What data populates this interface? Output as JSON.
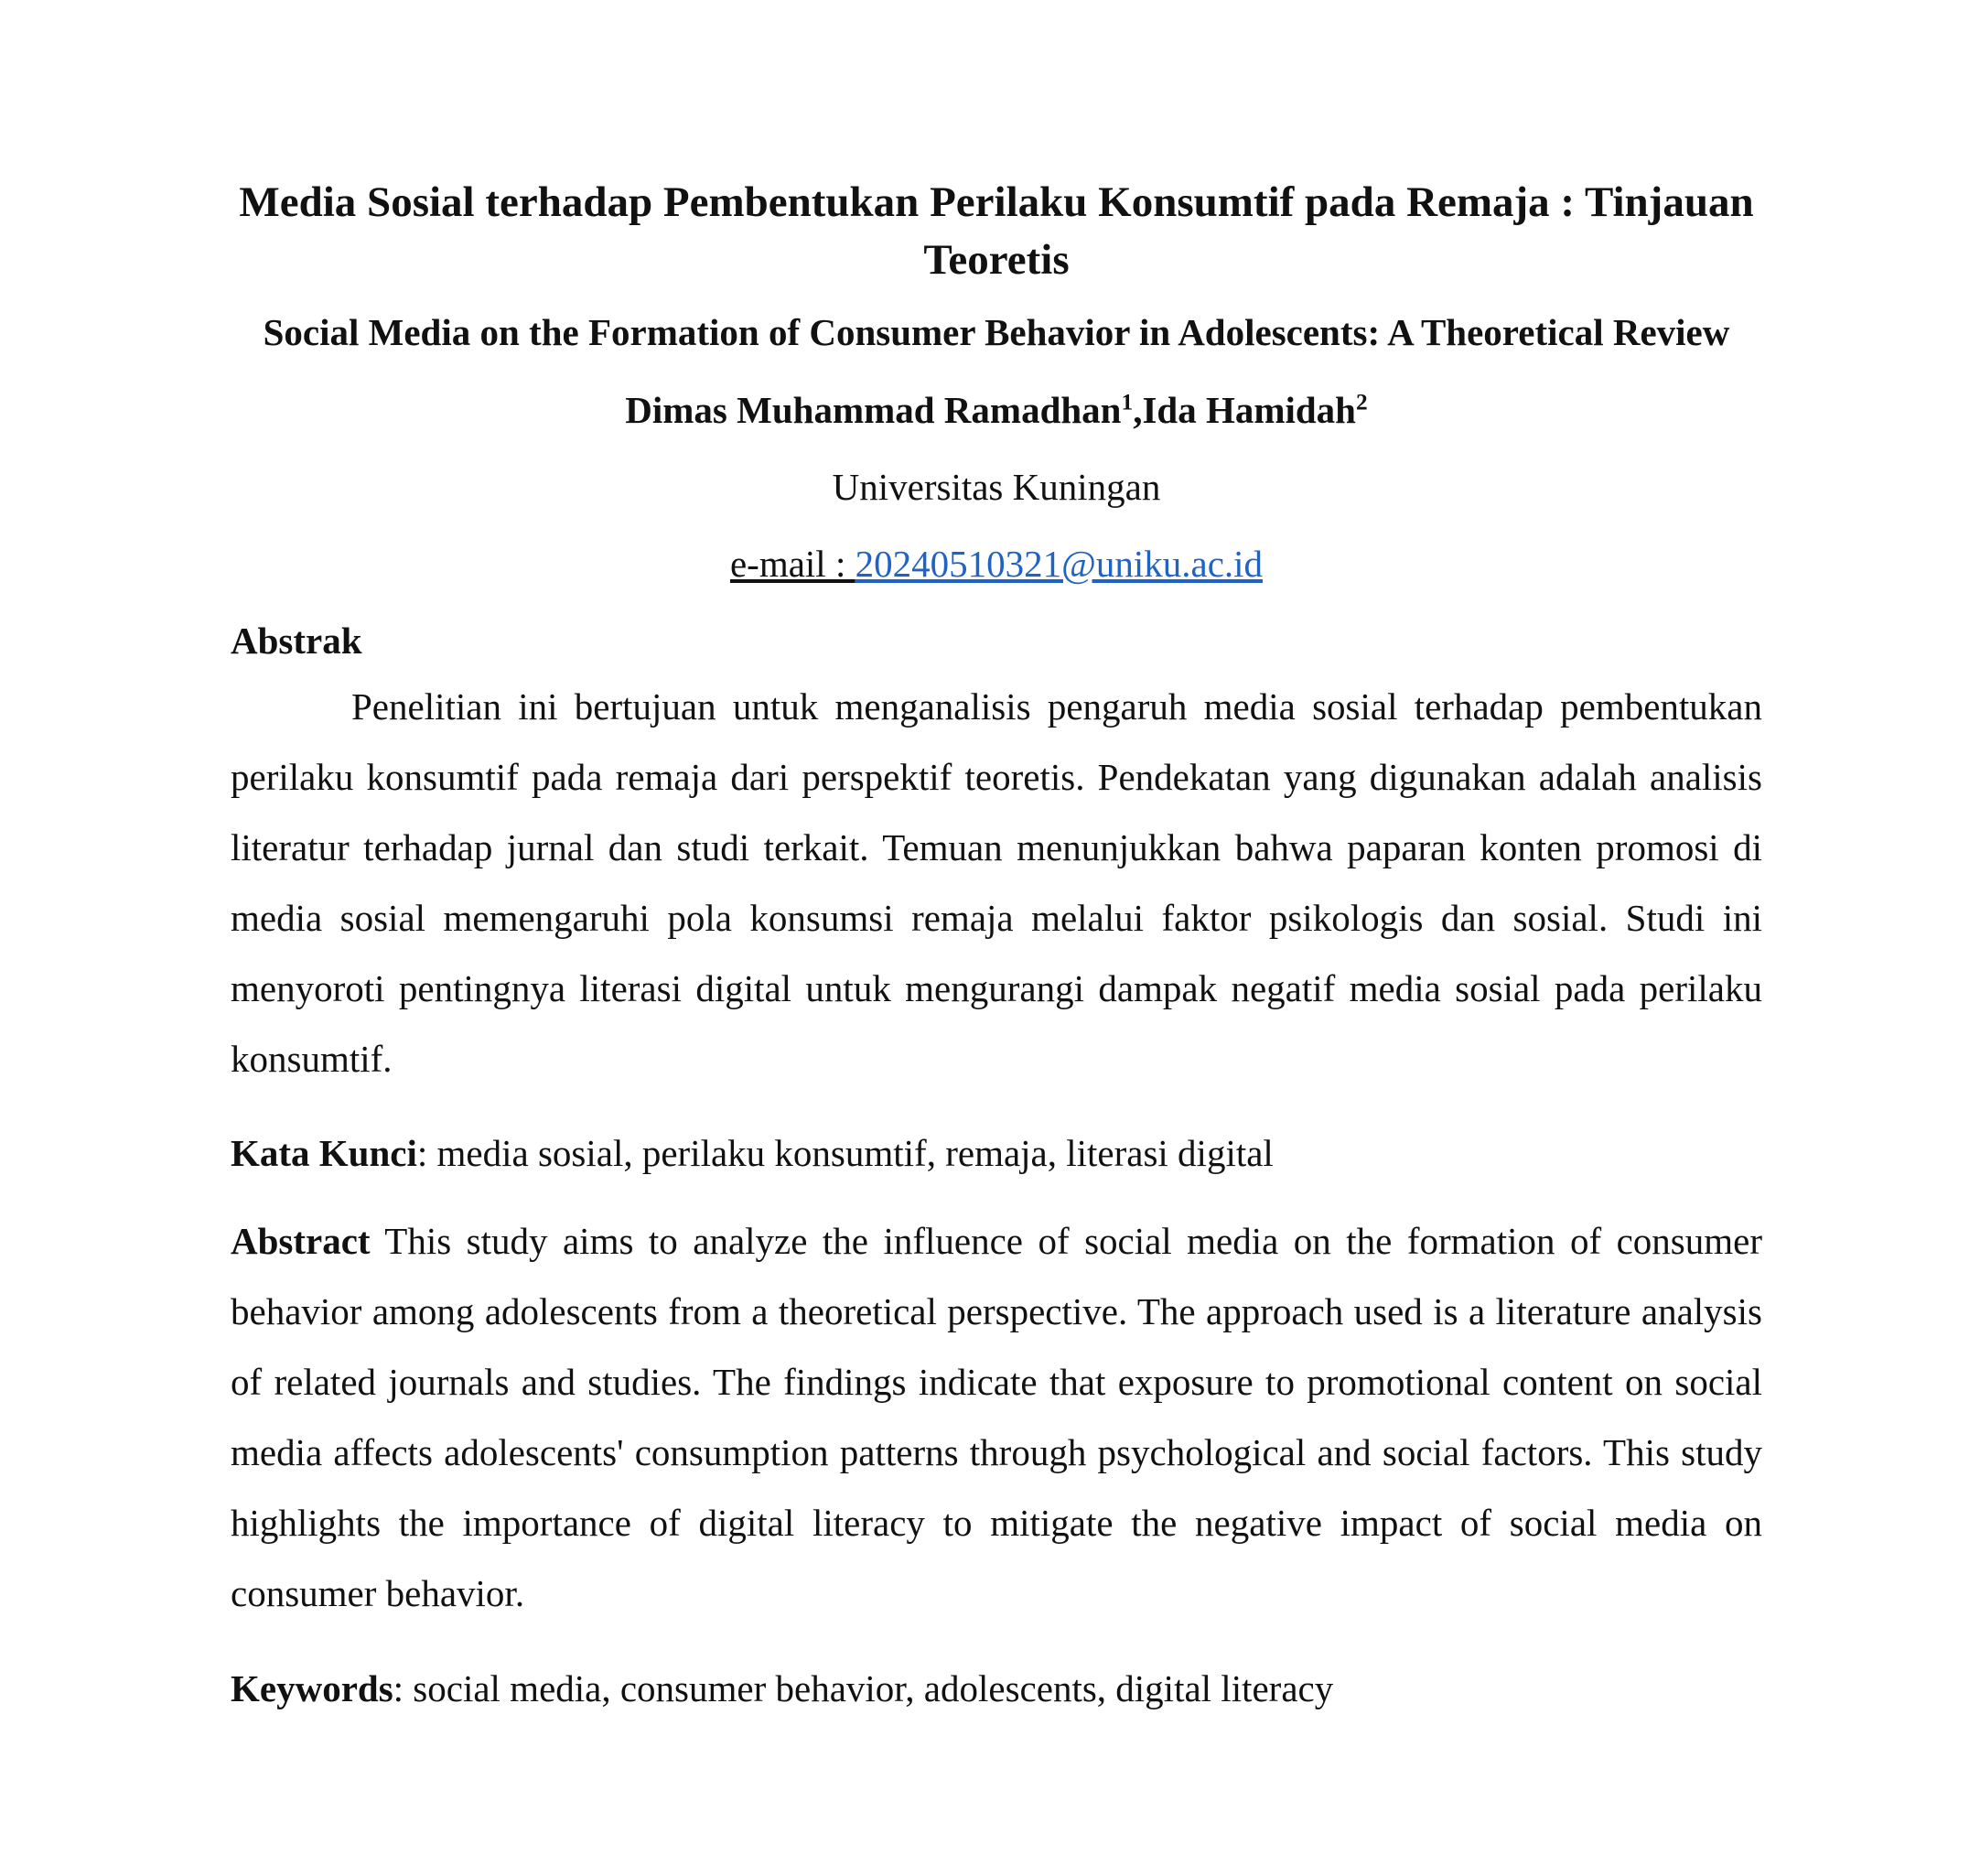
{
  "title": "Media Sosial terhadap Pembentukan Perilaku Konsumtif pada Remaja : Tinjauan Teoretis",
  "subtitle": "Social Media on the Formation of Consumer Behavior in Adolescents: A Theoretical Review",
  "authors": {
    "author1": "Dimas Muhammad Ramadhan",
    "author1_mark": "1",
    "separator": ",",
    "author2": "Ida Hamidah",
    "author2_mark": "2"
  },
  "affiliation": "Universitas Kuningan",
  "email": {
    "label": "e-mail : ",
    "address": "20240510321@uniku.ac.id"
  },
  "abstrak": {
    "heading": "Abstrak",
    "body": "Penelitian ini bertujuan untuk menganalisis pengaruh media sosial terhadap pembentukan perilaku konsumtif pada remaja dari perspektif teoretis. Pendekatan yang digunakan adalah analisis literatur terhadap jurnal dan studi terkait. Temuan menunjukkan bahwa paparan konten promosi di media sosial memengaruhi pola konsumsi remaja melalui faktor psikologis dan sosial. Studi ini menyoroti pentingnya literasi digital untuk mengurangi dampak negatif media sosial pada perilaku konsumtif."
  },
  "kata_kunci": {
    "label": "Kata Kunci",
    "value": ": media sosial, perilaku konsumtif, remaja, literasi digital"
  },
  "abstract": {
    "heading": "Abstract",
    "body": " This study aims to analyze the influence of social media on the formation of consumer behavior among adolescents from a theoretical perspective. The approach used is a literature analysis of related journals and studies. The findings indicate that exposure to promotional content on social media affects adolescents' consumption patterns through psychological and social factors. This study highlights the importance of digital literacy to mitigate the negative impact of social media on consumer behavior."
  },
  "keywords": {
    "label": "Keywords",
    "value": ": social media, consumer behavior, adolescents, digital literacy"
  },
  "colors": {
    "text": "#111111",
    "link": "#1f63c6"
  }
}
